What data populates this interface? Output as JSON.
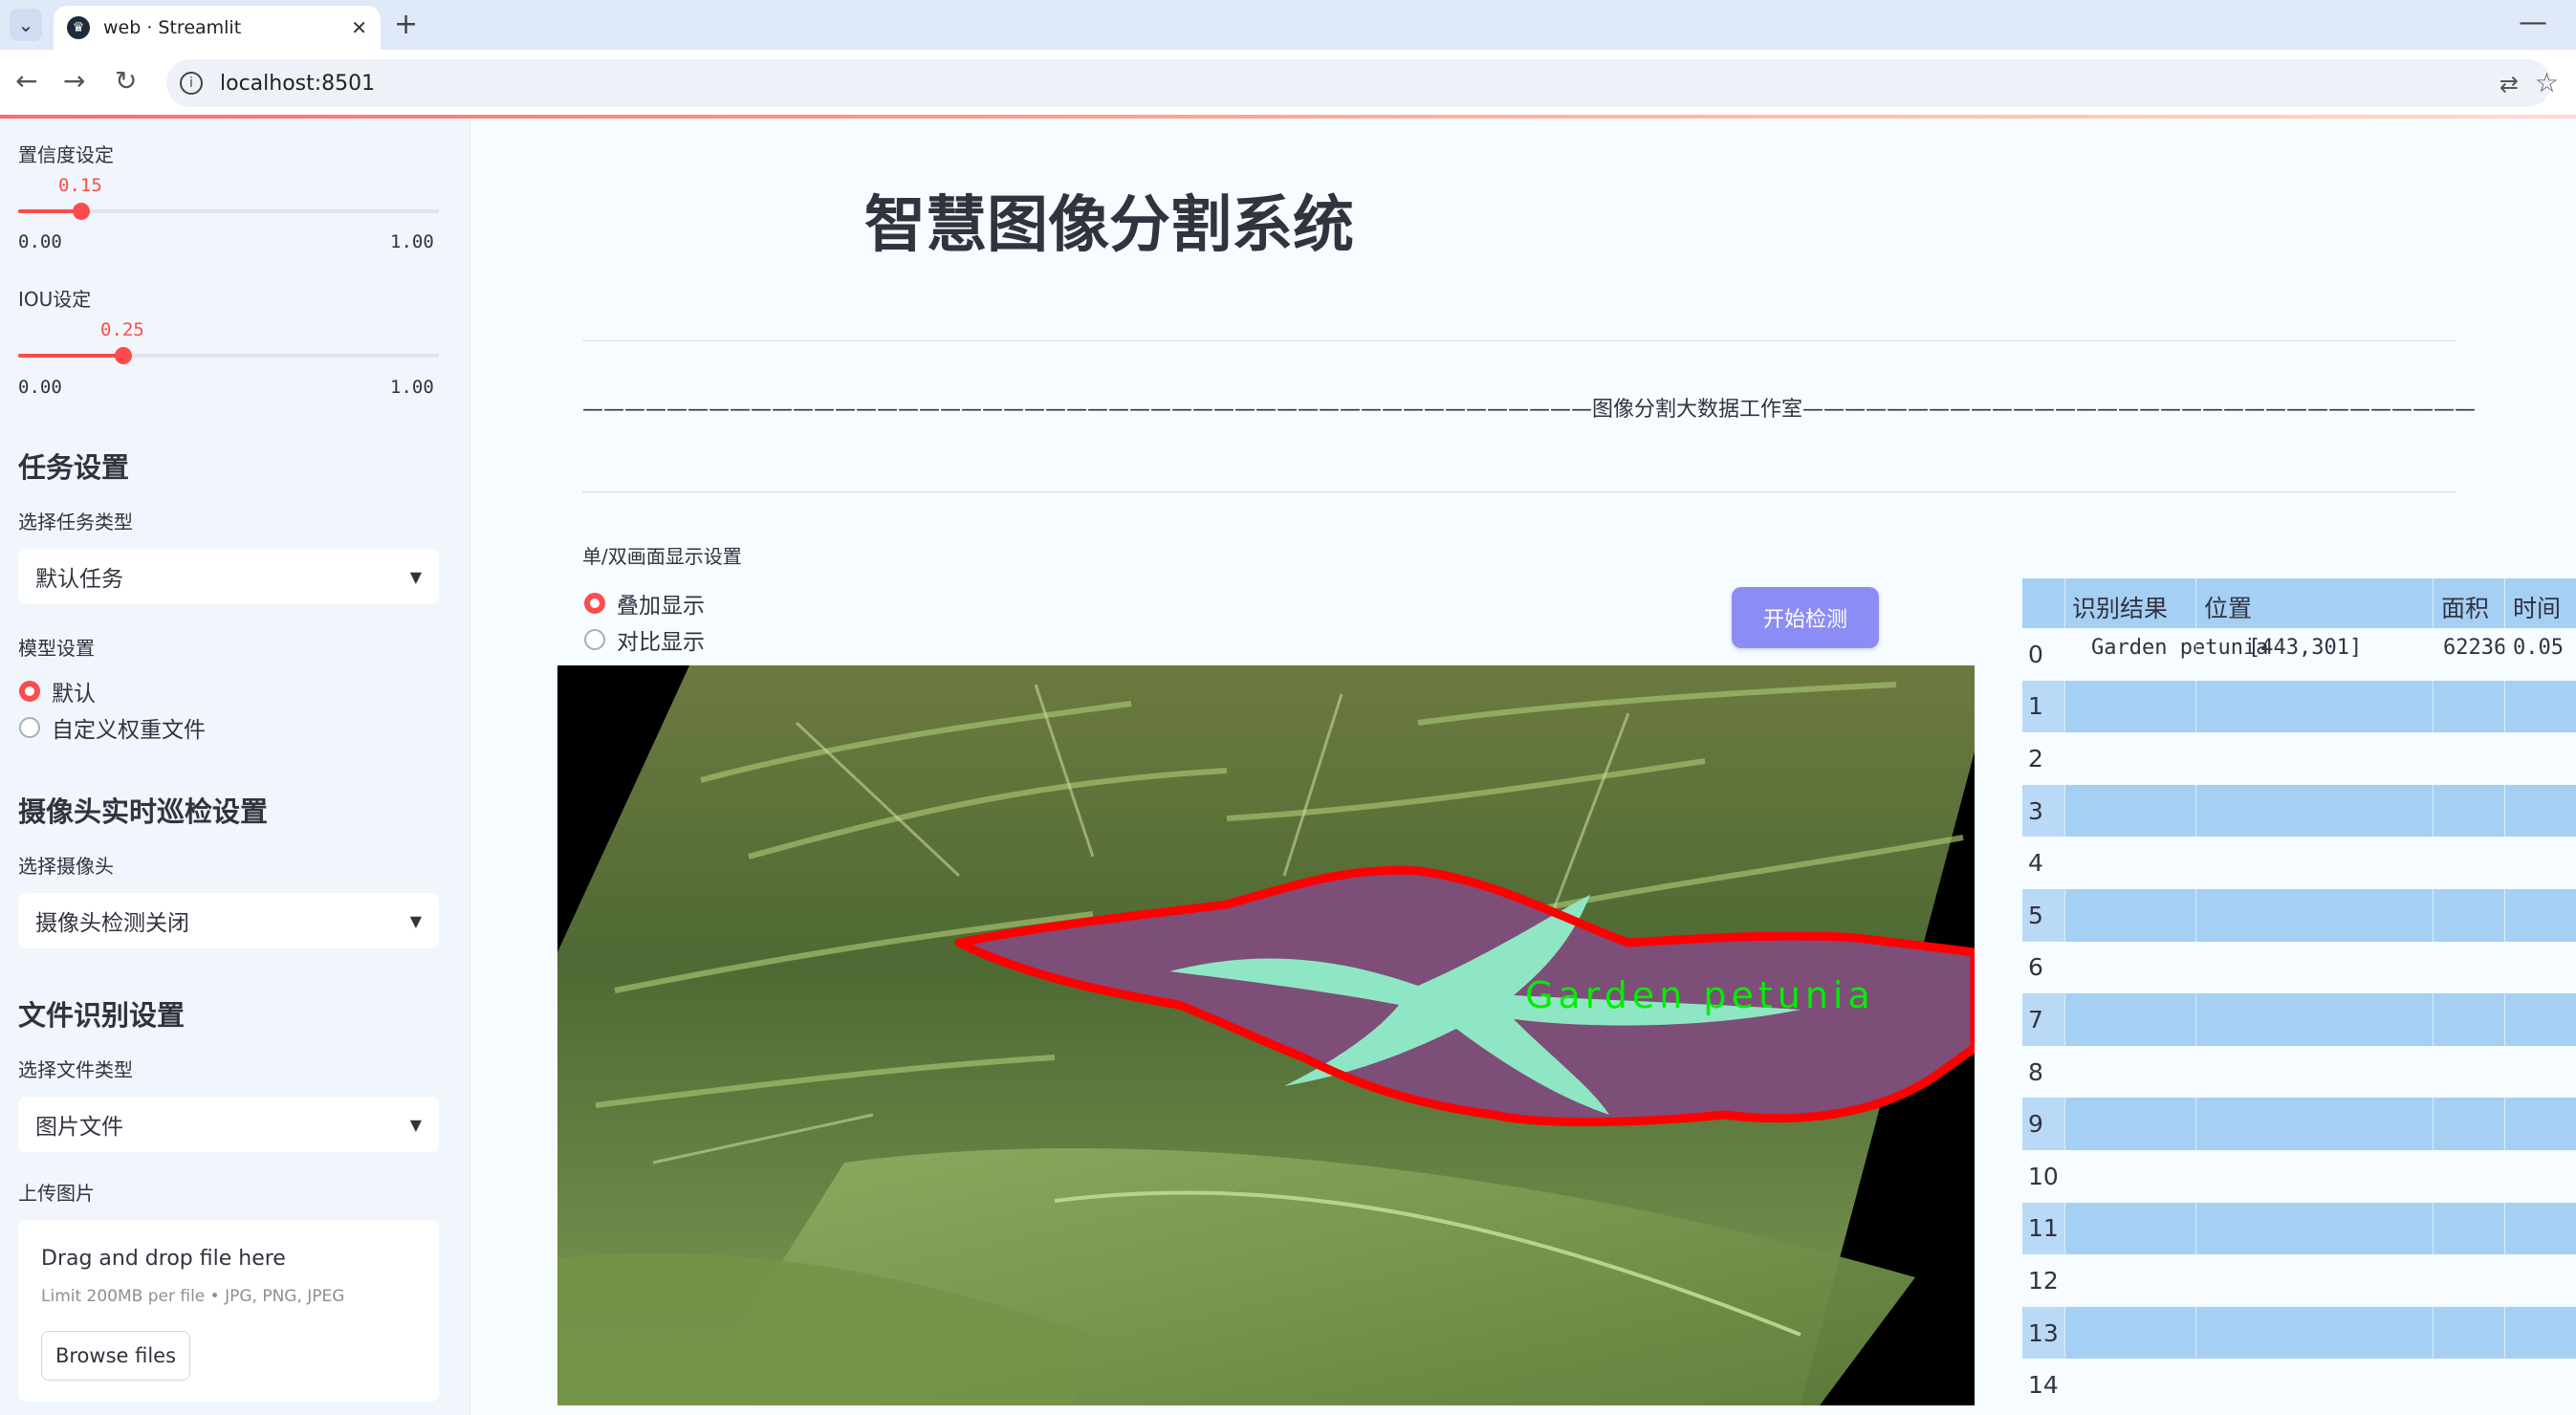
{
  "browser": {
    "tab_title": "web · Streamlit",
    "new_tab": "+",
    "minimize": "—",
    "url": "localhost:8501"
  },
  "sidebar": {
    "confidence": {
      "label": "置信度设定",
      "value": "0.15",
      "fraction": 0.15,
      "min": "0.00",
      "max": "1.00"
    },
    "iou": {
      "label": "IOU设定",
      "value": "0.25",
      "fraction": 0.25,
      "min": "0.00",
      "max": "1.00"
    },
    "task_heading": "任务设置",
    "task_type_label": "选择任务类型",
    "task_type_value": "默认任务",
    "model_label": "模型设置",
    "model_options": [
      "默认",
      "自定义权重文件"
    ],
    "model_selected": 0,
    "camera_heading": "摄像头实时巡检设置",
    "camera_label": "选择摄像头",
    "camera_value": "摄像头检测关闭",
    "file_heading": "文件识别设置",
    "file_type_label": "选择文件类型",
    "file_type_value": "图片文件",
    "upload_label": "上传图片",
    "upload_title": "Drag and drop file here",
    "upload_limit": "Limit 200MB per file • JPG, PNG, JPEG",
    "upload_button": "Browse files"
  },
  "main": {
    "title": "智慧图像分割系统",
    "studio_line": "————————————————————————————————————————————————图像分割大数据工作室————————————————————————————————————————————————",
    "display_mode_label": "单/双画面显示设置",
    "display_options": [
      "叠加显示",
      "对比显示"
    ],
    "display_selected": 0,
    "start_button": "开始检测",
    "detection_label": "Garden petunia"
  },
  "results": {
    "columns": [
      "识别结果",
      "位置",
      "面积",
      "时间"
    ],
    "rows": [
      {
        "index": "0",
        "result": "Garden petunia",
        "position": "[443,301]",
        "area": "62236",
        "time": "0.05"
      },
      {
        "index": "1"
      },
      {
        "index": "2"
      },
      {
        "index": "3"
      },
      {
        "index": "4"
      },
      {
        "index": "5"
      },
      {
        "index": "6"
      },
      {
        "index": "7"
      },
      {
        "index": "8"
      },
      {
        "index": "9"
      },
      {
        "index": "10"
      },
      {
        "index": "11"
      },
      {
        "index": "12"
      },
      {
        "index": "13"
      },
      {
        "index": "14"
      }
    ]
  },
  "colors": {
    "accent": "#ff4b4b",
    "button": "#8c8cf5",
    "table_stripe": "#a6cff4",
    "mask_outline": "#ff0000",
    "label_green": "#00ee00"
  }
}
